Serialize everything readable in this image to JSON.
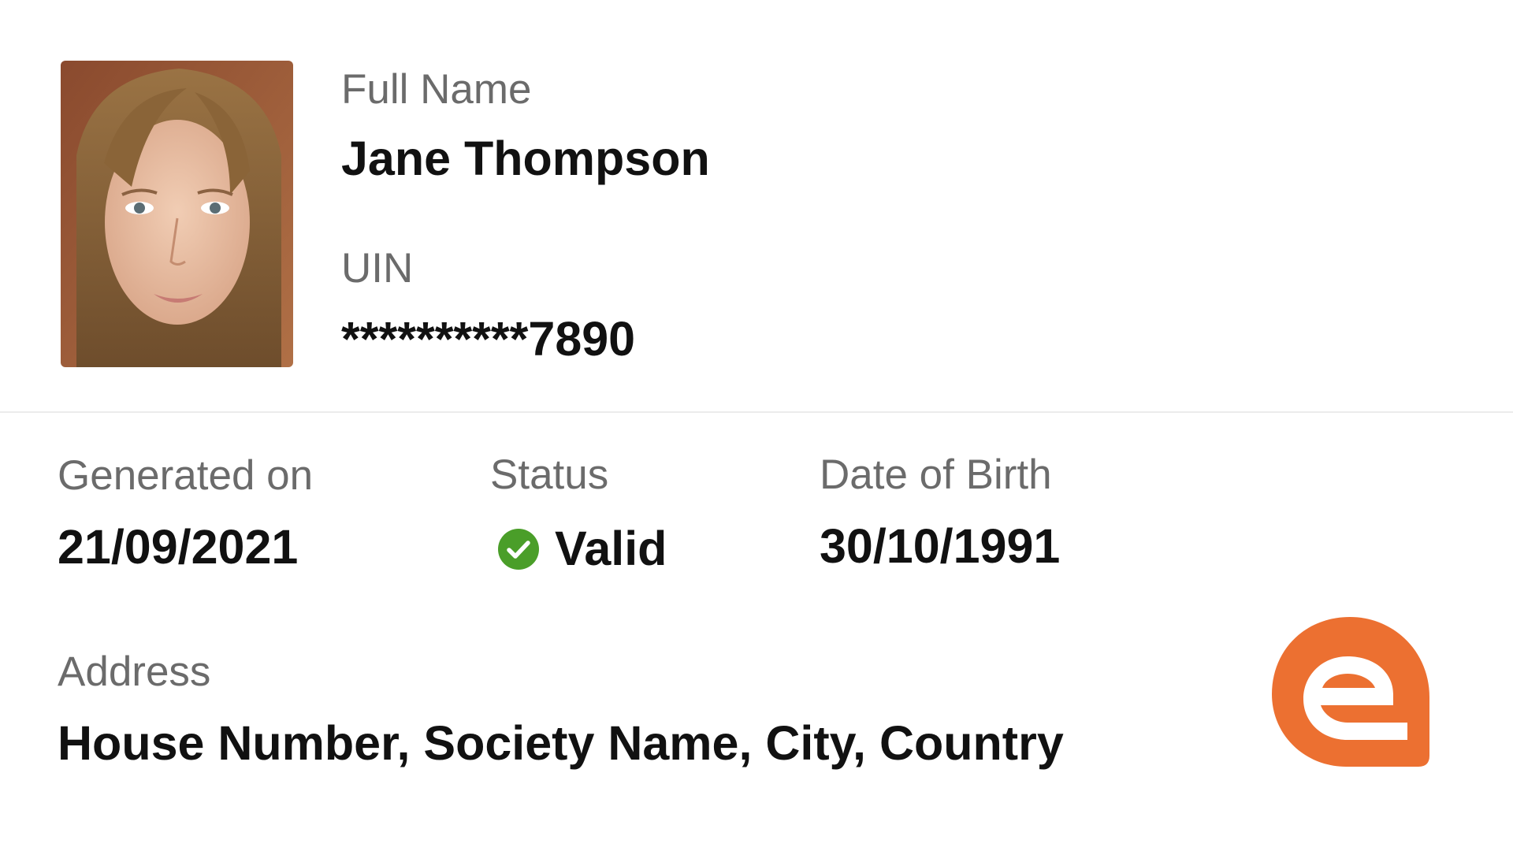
{
  "profile": {
    "photo_alt": "profile photo",
    "full_name_label": "Full Name",
    "full_name_value": "Jane Thompson",
    "uin_label": "UIN",
    "uin_value": "**********7890"
  },
  "details": {
    "generated_on_label": "Generated on",
    "generated_on_value": "21/09/2021",
    "status_label": "Status",
    "status_value": "Valid",
    "dob_label": "Date of Birth",
    "dob_value": "30/10/1991",
    "address_label": "Address",
    "address_value": "House Number, Society Name, City, Country"
  },
  "icons": {
    "status": "check-circle-icon",
    "logo": "brand-logo"
  },
  "colors": {
    "status_green": "#4a9e29",
    "brand_orange": "#ec7031",
    "label_gray": "#6b6b6b",
    "divider": "#ececec"
  }
}
